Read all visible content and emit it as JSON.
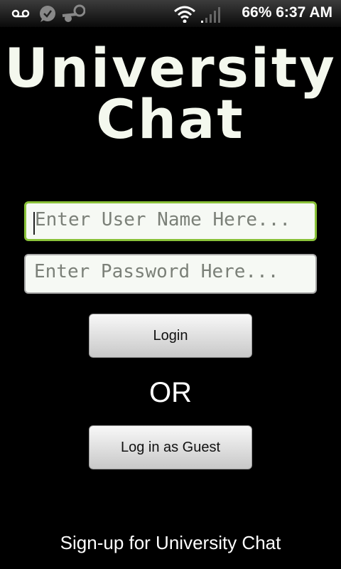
{
  "status_bar": {
    "battery": "66%",
    "time": "6:37 AM",
    "icons": [
      "voicemail-icon",
      "chat-check-icon",
      "steam-icon",
      "wifi-icon",
      "signal-icon"
    ]
  },
  "title": {
    "line1": "University",
    "line2": "Chat"
  },
  "form": {
    "username_placeholder": "Enter User Name Here...",
    "password_placeholder": "Enter Password Here...",
    "login_label": "Login",
    "or_label": "OR",
    "guest_label": "Log in as Guest"
  },
  "signup_link": "Sign-up for University Chat",
  "colors": {
    "focus_border": "#8ac23a",
    "background": "#000000"
  }
}
